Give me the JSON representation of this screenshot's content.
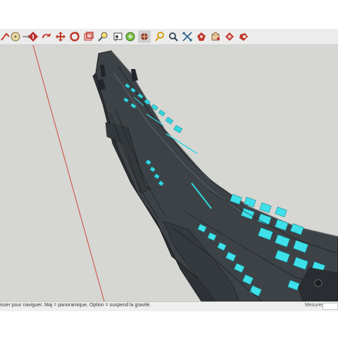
{
  "toolbar": {
    "tools": [
      {
        "name": "dimension-icon",
        "color": "#c0392b"
      },
      {
        "name": "protractor-icon",
        "color": "#7a6a3a"
      },
      {
        "name": "axes-icon",
        "color": "#c0392b"
      },
      {
        "name": "text-icon",
        "color": "#c0392b"
      },
      {
        "name": "move-icon",
        "color": "#c0392b"
      },
      {
        "name": "rotate-icon",
        "color": "#c0392b"
      },
      {
        "name": "section-plane-icon",
        "color": "#c0392b"
      },
      {
        "name": "look-around-icon",
        "color": "#2c3e50"
      },
      {
        "name": "position-camera-icon",
        "color": "#2c3e50"
      },
      {
        "name": "orbit-icon",
        "color": "#27ae60"
      },
      {
        "name": "pan-icon",
        "color": "#2c3e50"
      },
      {
        "name": "walk-icon",
        "color": "#d4a017"
      },
      {
        "name": "zoom-icon",
        "color": "#2c3e50"
      },
      {
        "name": "zoom-extents-icon",
        "color": "#c0392b"
      },
      {
        "name": "geo-location-icon",
        "color": "#c0392b"
      },
      {
        "name": "warehouse-icon",
        "color": "#c0392b"
      },
      {
        "name": "extension-icon",
        "color": "#c0392b"
      }
    ],
    "active_tool": "walk-icon"
  },
  "viewport": {
    "background": "#d6d6d2",
    "model": "spaceship",
    "hull_color": "#3a3f43",
    "accent_color": "#33d6e0"
  },
  "status": {
    "text": "isser pour naviguer. Maj = panoramique, Option =  suspend la gravité.",
    "measure_label": "Mesures",
    "measure_value": ""
  }
}
